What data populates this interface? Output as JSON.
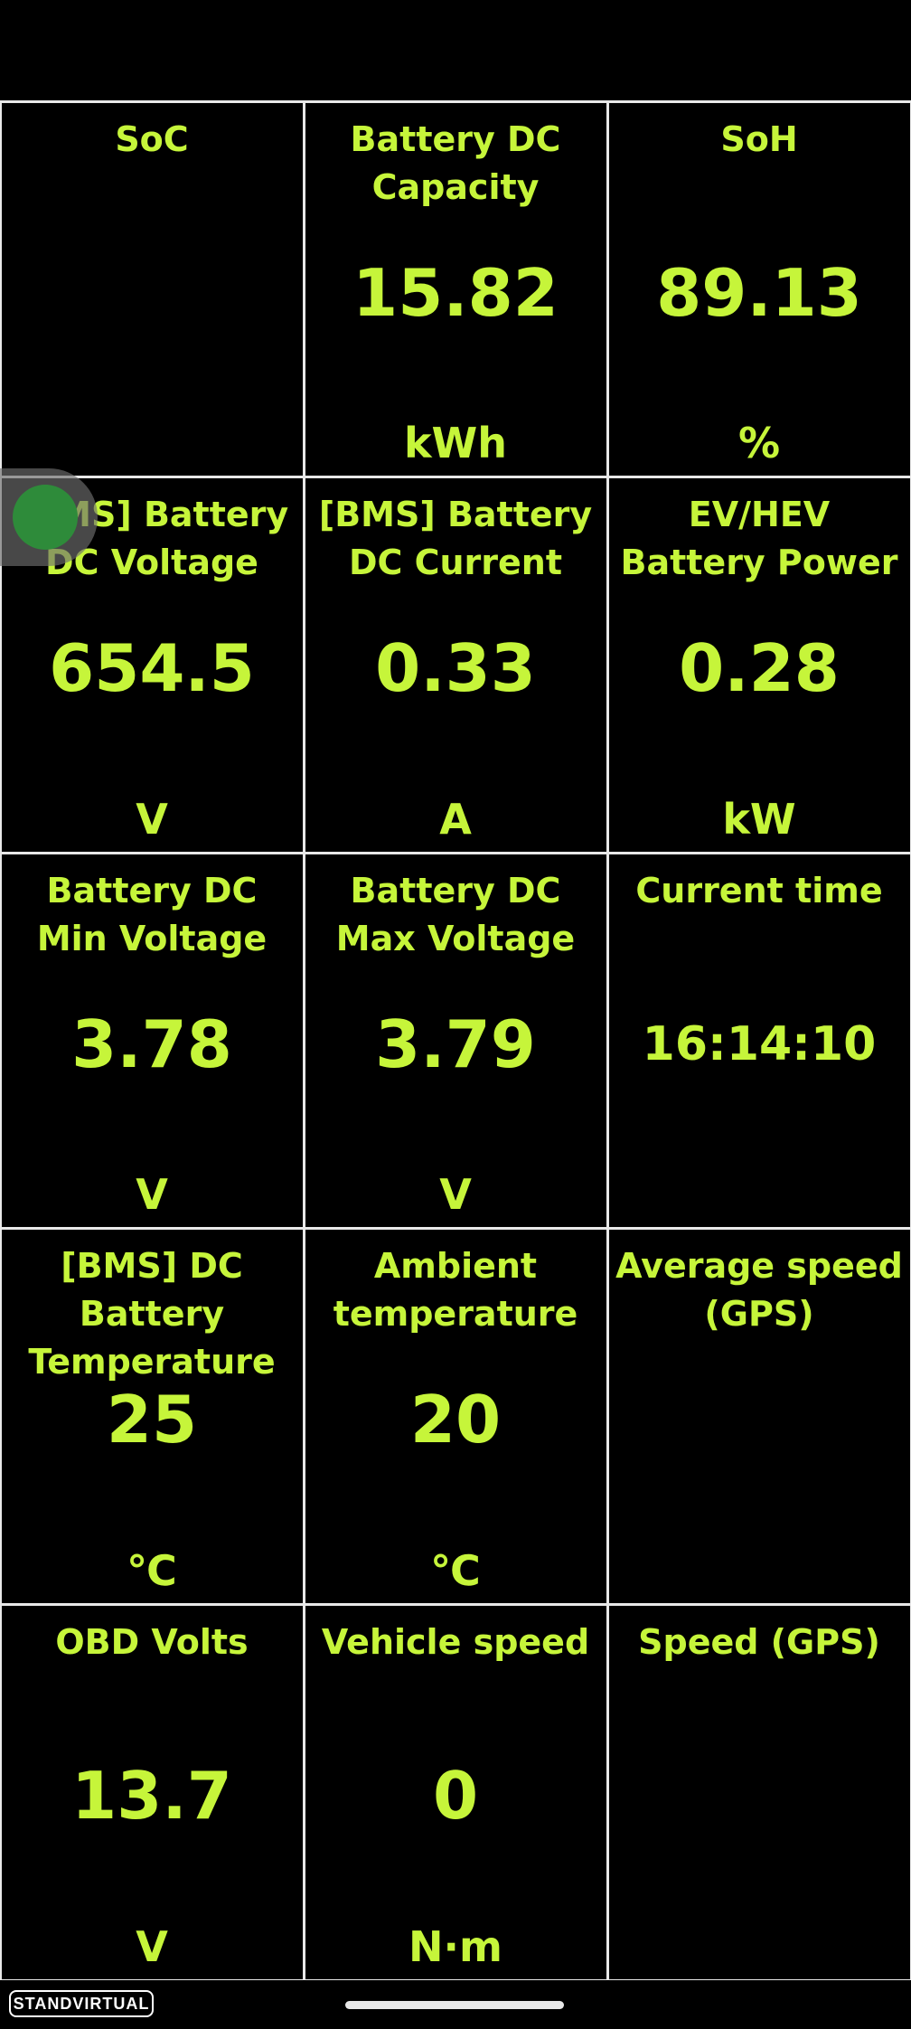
{
  "cells": [
    {
      "label": "SoC",
      "value": "",
      "unit": ""
    },
    {
      "label": "Battery DC Capacity",
      "value": "15.82",
      "unit": "kWh"
    },
    {
      "label": "SoH",
      "value": "89.13",
      "unit": "%"
    },
    {
      "label": "[BMS] Battery DC Voltage",
      "value": "654.5",
      "unit": "V"
    },
    {
      "label": "[BMS] Battery DC Current",
      "value": "0.33",
      "unit": "A"
    },
    {
      "label": "EV/HEV Battery Power",
      "value": "0.28",
      "unit": "kW"
    },
    {
      "label": "Battery DC Min Voltage",
      "value": "3.78",
      "unit": "V"
    },
    {
      "label": "Battery DC Max Voltage",
      "value": "3.79",
      "unit": "V"
    },
    {
      "label": "Current time",
      "value": "16:14:10",
      "unit": ""
    },
    {
      "label": "[BMS] DC Battery Temperature",
      "value": "25",
      "unit": "℃"
    },
    {
      "label": "Ambient temperature",
      "value": "20",
      "unit": "℃"
    },
    {
      "label": "Average speed (GPS)",
      "value": "",
      "unit": ""
    },
    {
      "label": "OBD Volts",
      "value": "13.7",
      "unit": "V"
    },
    {
      "label": "Vehicle speed",
      "value": "0",
      "unit": "N·m"
    },
    {
      "label": "Speed (GPS)",
      "value": "",
      "unit": ""
    }
  ],
  "watermark": "STANDVIRTUAL",
  "colors": {
    "text": "#c6f53a",
    "background": "#000000",
    "border": "#e8e8e8"
  }
}
